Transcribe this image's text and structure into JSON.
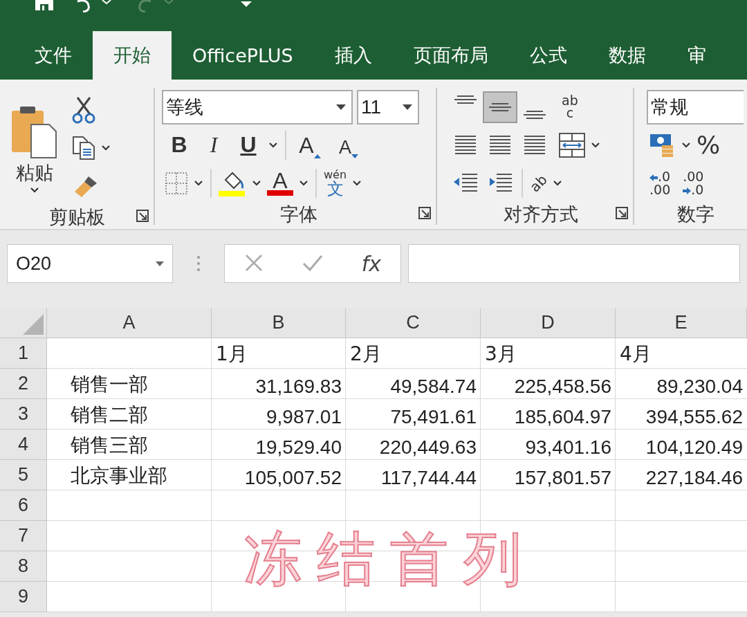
{
  "tabs": [
    {
      "label": "文件",
      "selected": false
    },
    {
      "label": "开始",
      "selected": true
    },
    {
      "label": "OfficePLUS",
      "selected": false
    },
    {
      "label": "插入",
      "selected": false
    },
    {
      "label": "页面布局",
      "selected": false
    },
    {
      "label": "公式",
      "selected": false
    },
    {
      "label": "数据",
      "selected": false
    },
    {
      "label": "审",
      "selected": false
    }
  ],
  "ribbon": {
    "clipboard": {
      "title": "剪贴板",
      "paste": "粘贴"
    },
    "font": {
      "title": "字体",
      "name": "等线",
      "size": "11",
      "bold": "B",
      "italic": "I",
      "underline": "U",
      "grow": "A",
      "shrink": "A",
      "font_color": "A",
      "phonetic_top": "wén",
      "phonetic_bottom": "文"
    },
    "alignment": {
      "title": "对齐方式",
      "vertical": [
        {
          "selected": false
        },
        {
          "selected": true
        },
        {
          "selected": false
        }
      ],
      "wrap_top": "ab",
      "wrap_bottom": "c",
      "orientation": "ab"
    },
    "number": {
      "title": "数字",
      "format": "常规",
      "percent": "%",
      "decimals": [
        {
          "top": ".0",
          "bottom": ".00"
        },
        {
          "top": ".00",
          "bottom": ".0"
        }
      ]
    }
  },
  "formula_bar": {
    "name_box": "O20",
    "fx": "fx"
  },
  "sheet": {
    "columns": [
      "A",
      "B",
      "C",
      "D",
      "E"
    ],
    "rows": [
      {
        "header": "1",
        "cells": [
          null,
          {
            "text": "1月",
            "kind": "text"
          },
          {
            "text": "2月",
            "kind": "text"
          },
          {
            "text": "3月",
            "kind": "text"
          },
          {
            "text": "4月",
            "kind": "text"
          }
        ]
      },
      {
        "header": "2",
        "cells": [
          {
            "text": "销售一部",
            "kind": "label"
          },
          {
            "text": "31,169.83",
            "kind": "number"
          },
          {
            "text": "49,584.74",
            "kind": "number"
          },
          {
            "text": "225,458.56",
            "kind": "number"
          },
          {
            "text": "89,230.04",
            "kind": "number"
          }
        ]
      },
      {
        "header": "3",
        "cells": [
          {
            "text": "销售二部",
            "kind": "label"
          },
          {
            "text": "9,987.01",
            "kind": "number"
          },
          {
            "text": "75,491.61",
            "kind": "number"
          },
          {
            "text": "185,604.97",
            "kind": "number"
          },
          {
            "text": "394,555.62",
            "kind": "number"
          }
        ]
      },
      {
        "header": "4",
        "cells": [
          {
            "text": "销售三部",
            "kind": "label"
          },
          {
            "text": "19,529.40",
            "kind": "number"
          },
          {
            "text": "220,449.63",
            "kind": "number"
          },
          {
            "text": "93,401.16",
            "kind": "number"
          },
          {
            "text": "104,120.49",
            "kind": "number"
          }
        ]
      },
      {
        "header": "5",
        "cells": [
          {
            "text": "北京事业部",
            "kind": "label"
          },
          {
            "text": "105,007.52",
            "kind": "number"
          },
          {
            "text": "117,744.44",
            "kind": "number"
          },
          {
            "text": "157,801.57",
            "kind": "number"
          },
          {
            "text": "227,184.46",
            "kind": "number"
          }
        ]
      },
      {
        "header": "6"
      },
      {
        "header": "7"
      },
      {
        "header": "8"
      },
      {
        "header": "9"
      }
    ]
  },
  "caption": "冻结首列"
}
